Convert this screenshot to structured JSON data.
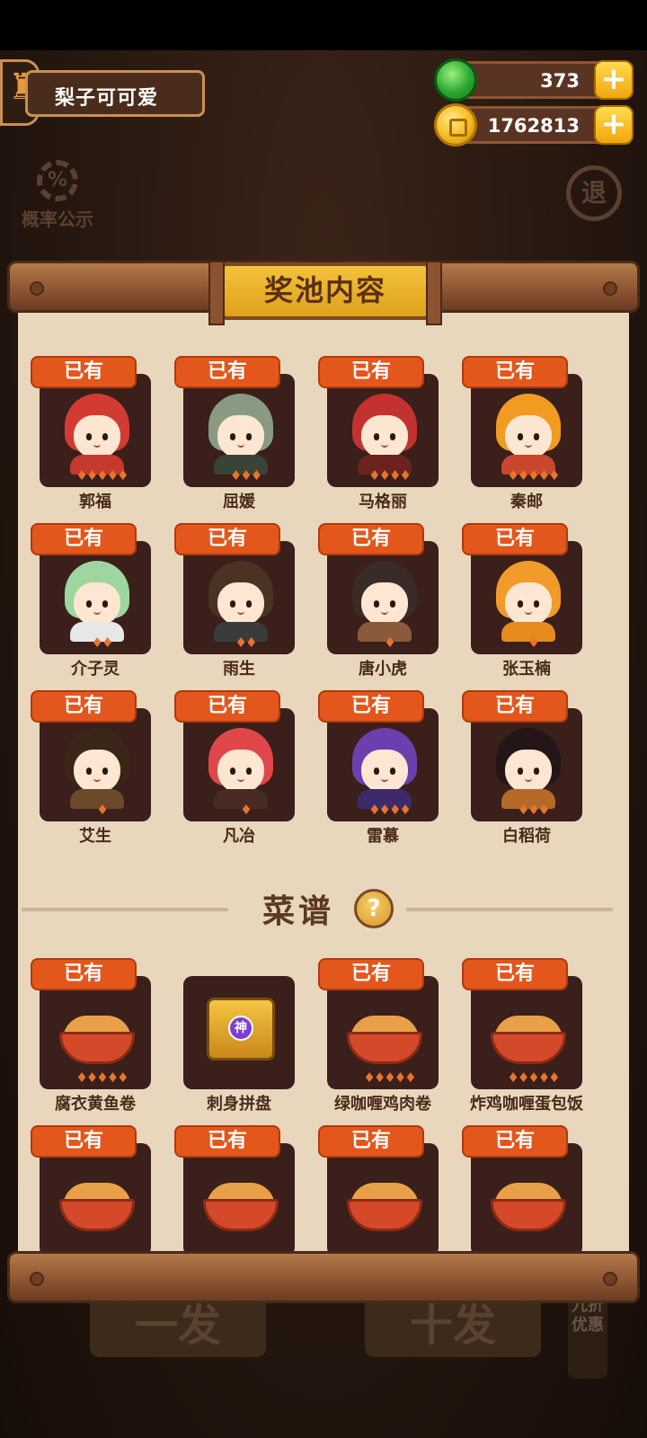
{
  "player": {
    "name": "梨子可可爱"
  },
  "currency": {
    "gems": "373",
    "coins": "1762813"
  },
  "background": {
    "probability_label": "概率公示",
    "exit_label": "退",
    "single_draw": "一发",
    "ten_draw": "十发",
    "discount": "九折优惠"
  },
  "panel": {
    "title": "奖池内容"
  },
  "owned_label": "已有",
  "characters": [
    {
      "name": "郭福",
      "stars": 5,
      "hair": "#d23b34",
      "outfit": "#c43a2d"
    },
    {
      "name": "屈媛",
      "stars": 3,
      "hair": "#8a9a82",
      "outfit": "#3a4436"
    },
    {
      "name": "马格丽",
      "stars": 4,
      "hair": "#c2322f",
      "outfit": "#6c2320"
    },
    {
      "name": "秦邮",
      "stars": 5,
      "hair": "#f29b21",
      "outfit": "#c8472d"
    },
    {
      "name": "介子灵",
      "stars": 2,
      "hair": "#9ed6a0",
      "outfit": "#e7e7e7"
    },
    {
      "name": "雨生",
      "stars": 2,
      "hair": "#4a3324",
      "outfit": "#3b3b3b"
    },
    {
      "name": "唐小虎",
      "stars": 1,
      "hair": "#3a2b26",
      "outfit": "#8a5b3a"
    },
    {
      "name": "张玉楠",
      "stars": 1,
      "hair": "#f19b2a",
      "outfit": "#e58a1b"
    },
    {
      "name": "艾生",
      "stars": 1,
      "hair": "#3a2618",
      "outfit": "#6a4a2a"
    },
    {
      "name": "凡冶",
      "stars": 1,
      "hair": "#e0474a",
      "outfit": "#4a2b24"
    },
    {
      "name": "雷慕",
      "stars": 4,
      "hair": "#6b3fae",
      "outfit": "#3d2a6a"
    },
    {
      "name": "白稻荷",
      "stars": 3,
      "hair": "#241617",
      "outfit": "#b7692a"
    }
  ],
  "recipe_section": {
    "label": "菜谱",
    "help_icon": "?"
  },
  "recipes": [
    {
      "name": "腐衣黄鱼卷",
      "stars": 5,
      "owned": true,
      "art": "dish"
    },
    {
      "name": "刺身拼盘",
      "stars": 0,
      "owned": false,
      "art": "treasure",
      "badge": "神"
    },
    {
      "name": "绿咖喱鸡肉卷",
      "stars": 5,
      "owned": true,
      "art": "dish"
    },
    {
      "name": "炸鸡咖喱蛋包饭",
      "stars": 5,
      "owned": true,
      "art": "dish"
    },
    {
      "name": "",
      "stars": 0,
      "owned": true,
      "art": "dish"
    },
    {
      "name": "",
      "stars": 0,
      "owned": true,
      "art": "dish"
    },
    {
      "name": "",
      "stars": 0,
      "owned": true,
      "art": "dish"
    },
    {
      "name": "",
      "stars": 0,
      "owned": true,
      "art": "dish"
    }
  ],
  "colors": {
    "badge": "#e3571c",
    "paper": "#e8d7bd",
    "tile": "#3a1f1b",
    "gold": "#f3c23b"
  }
}
